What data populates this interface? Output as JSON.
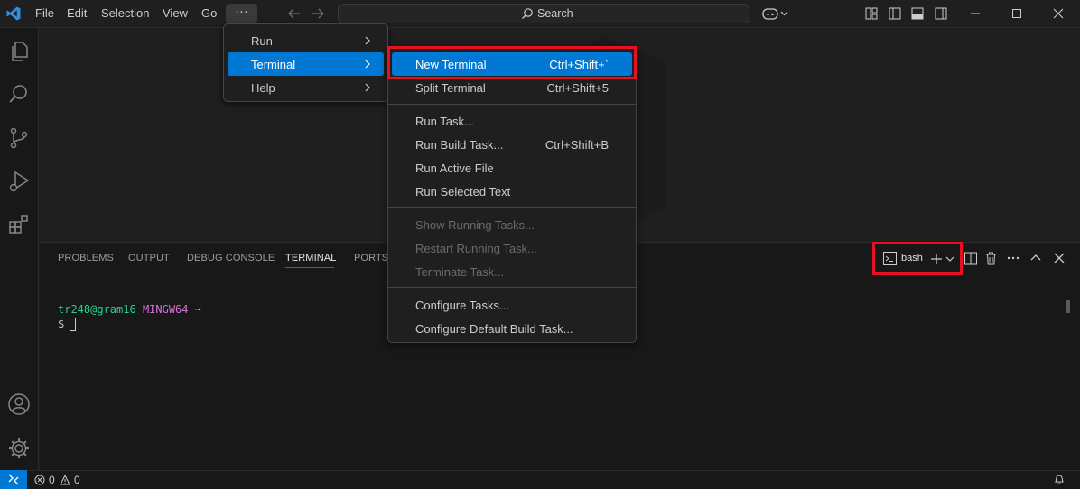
{
  "titlebar": {
    "menus": [
      "File",
      "Edit",
      "Selection",
      "View",
      "Go"
    ],
    "more_label": "···",
    "search_placeholder": "Search"
  },
  "panel": {
    "tabs": [
      "PROBLEMS",
      "OUTPUT",
      "DEBUG CONSOLE",
      "TERMINAL",
      "PORTS"
    ],
    "active_tab": "TERMINAL",
    "terminal_profile": "bash"
  },
  "terminal": {
    "user_host": "tr248@gram16",
    "env": "MINGW64",
    "cwd": "~",
    "prompt": "$"
  },
  "menus": {
    "more_menu": [
      {
        "label": "Run",
        "has_submenu": true
      },
      {
        "label": "Terminal",
        "has_submenu": true,
        "selected": true
      },
      {
        "label": "Help",
        "has_submenu": true
      }
    ],
    "terminal_menu": {
      "group1": [
        {
          "label": "New Terminal",
          "shortcut": "Ctrl+Shift+`"
        },
        {
          "label": "Split Terminal",
          "shortcut": "Ctrl+Shift+5"
        }
      ],
      "group2": [
        {
          "label": "Run Task...",
          "shortcut": ""
        },
        {
          "label": "Run Build Task...",
          "shortcut": "Ctrl+Shift+B"
        },
        {
          "label": "Run Active File",
          "shortcut": ""
        },
        {
          "label": "Run Selected Text",
          "shortcut": ""
        }
      ],
      "group3": [
        {
          "label": "Show Running Tasks...",
          "disabled": true
        },
        {
          "label": "Restart Running Task...",
          "disabled": true
        },
        {
          "label": "Terminate Task...",
          "disabled": true
        }
      ],
      "group4": [
        {
          "label": "Configure Tasks..."
        },
        {
          "label": "Configure Default Build Task..."
        }
      ]
    }
  },
  "statusbar": {
    "errors": "0",
    "warnings": "0"
  },
  "colors": {
    "accent": "#0078d4",
    "highlight_box": "#e81123",
    "term_green": "#23d18b",
    "term_magenta": "#d670d6",
    "term_yellow": "#e5e510"
  }
}
